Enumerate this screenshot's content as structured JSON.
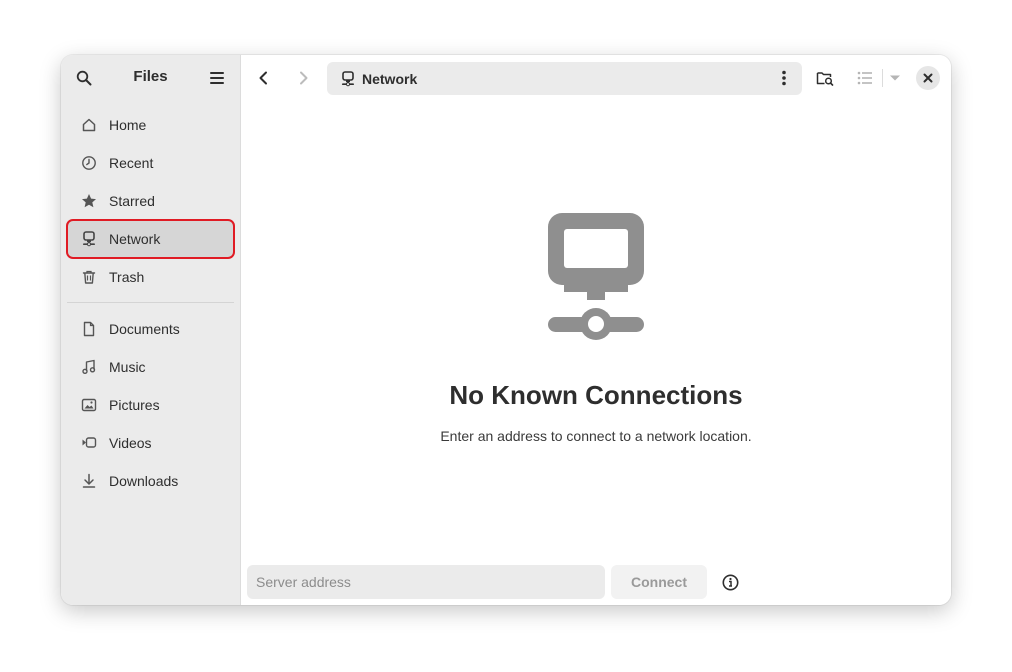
{
  "sidebar": {
    "title": "Files",
    "places": [
      {
        "label": "Home",
        "icon": "home-icon"
      },
      {
        "label": "Recent",
        "icon": "clock-icon"
      },
      {
        "label": "Starred",
        "icon": "star-icon"
      },
      {
        "label": "Network",
        "icon": "network-icon",
        "active": true
      },
      {
        "label": "Trash",
        "icon": "trash-icon"
      }
    ],
    "bookmarks": [
      {
        "label": "Documents",
        "icon": "document-icon"
      },
      {
        "label": "Music",
        "icon": "music-icon"
      },
      {
        "label": "Pictures",
        "icon": "picture-icon"
      },
      {
        "label": "Videos",
        "icon": "video-icon"
      },
      {
        "label": "Downloads",
        "icon": "download-icon"
      }
    ]
  },
  "pathbar": {
    "label": "Network",
    "icon": "network-icon"
  },
  "empty_state": {
    "title": "No Known Connections",
    "description": "Enter an address to connect to a network location."
  },
  "footer": {
    "server_placeholder": "Server address",
    "server_value": "",
    "connect_label": "Connect"
  },
  "colors": {
    "sidebar_bg": "#ebebeb",
    "selection_outline": "#e01b24",
    "icon_gray": "#8f8f8f"
  }
}
